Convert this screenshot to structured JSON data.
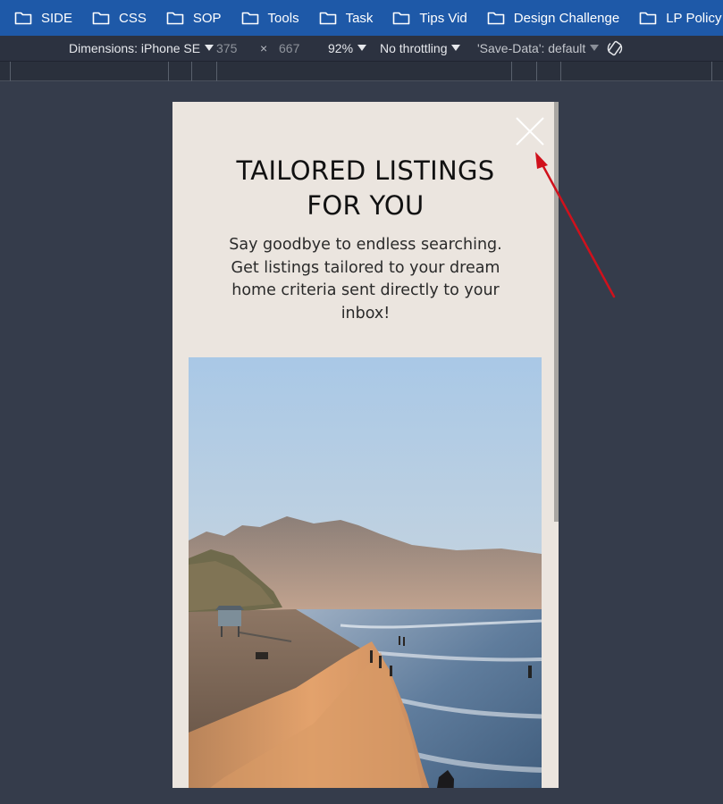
{
  "bookmarks": [
    {
      "label": "SIDE",
      "icon": "folder-icon"
    },
    {
      "label": "CSS",
      "icon": "folder-icon"
    },
    {
      "label": "SOP",
      "icon": "folder-icon"
    },
    {
      "label": "Tools",
      "icon": "folder-icon"
    },
    {
      "label": "Task",
      "icon": "folder-icon"
    },
    {
      "label": "Tips Vid",
      "icon": "folder-icon"
    },
    {
      "label": "Design Challenge",
      "icon": "folder-icon"
    },
    {
      "label": "LP Policy",
      "icon": "folder-icon"
    }
  ],
  "device_toolbar": {
    "dimensions_label": "Dimensions: iPhone SE",
    "width": "375",
    "times": "×",
    "height": "667",
    "zoom": "92%",
    "throttling": "No throttling",
    "save_data": "'Save-Data': default",
    "rotate_icon": "rotate-icon"
  },
  "popup": {
    "headline_line1": "TAILORED LISTINGS",
    "headline_line2": "FOR YOU",
    "subtext_line1": "Say goodbye to endless searching.",
    "subtext_line2": "Get listings tailored to your dream",
    "subtext_line3": "home criteria sent directly to your",
    "subtext_line4": "inbox!",
    "close_icon": "close-icon",
    "image": "beach-sunset-photo"
  },
  "colors": {
    "bookmarks_bg": "#1e59a8",
    "toolbar_bg": "#2c3240",
    "page_bg": "#353c4b",
    "popup_bg": "#ebe5df",
    "annotation_arrow": "#d0111c"
  }
}
